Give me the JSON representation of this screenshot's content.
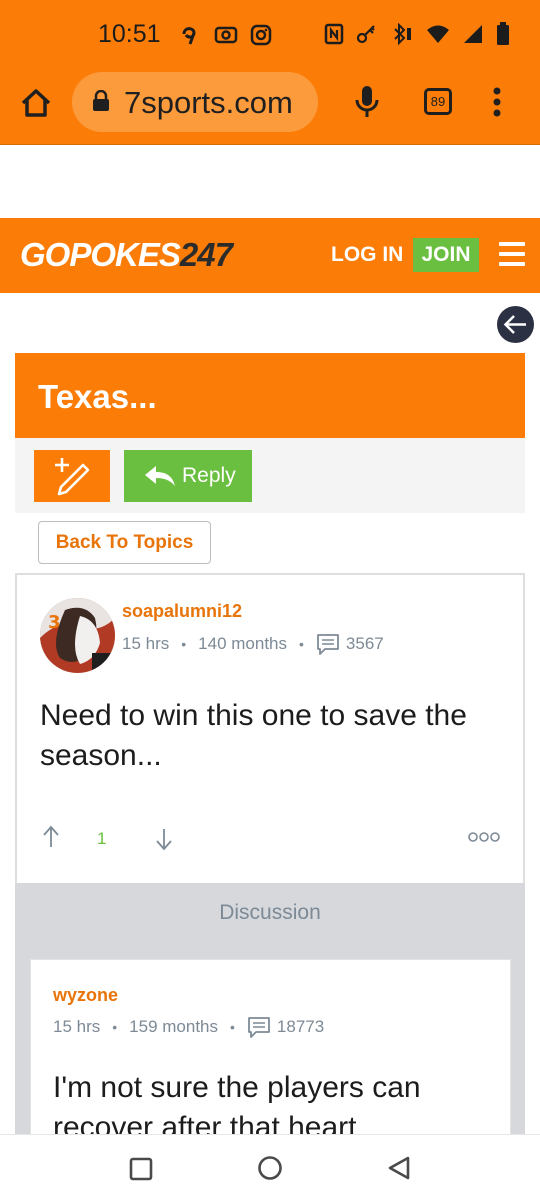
{
  "status_bar": {
    "time": "10:51"
  },
  "browser": {
    "url": "7sports.com",
    "tab_count": "89"
  },
  "site": {
    "logo_text": "GOPOKES",
    "logo_number": "247",
    "login_label": "LOG IN",
    "join_label": "JOIN"
  },
  "thread": {
    "title": "Texas...",
    "reply_label": "Reply",
    "back_label": "Back To Topics"
  },
  "post": {
    "username": "soapalumni12",
    "time_ago": "15 hrs",
    "tenure": "140 months",
    "post_count": "3567",
    "body": "Need to win this one to save the season...",
    "votes": "1"
  },
  "discussion": {
    "label": "Discussion"
  },
  "reply": {
    "username": "wyzone",
    "time_ago": "15 hrs",
    "tenure": "159 months",
    "post_count": "18773",
    "body": "I'm not sure the players can recover after that heart"
  },
  "colors": {
    "brand_orange": "#fb7d08",
    "join_green": "#6abf40",
    "meta_gray": "#7d8a96"
  }
}
